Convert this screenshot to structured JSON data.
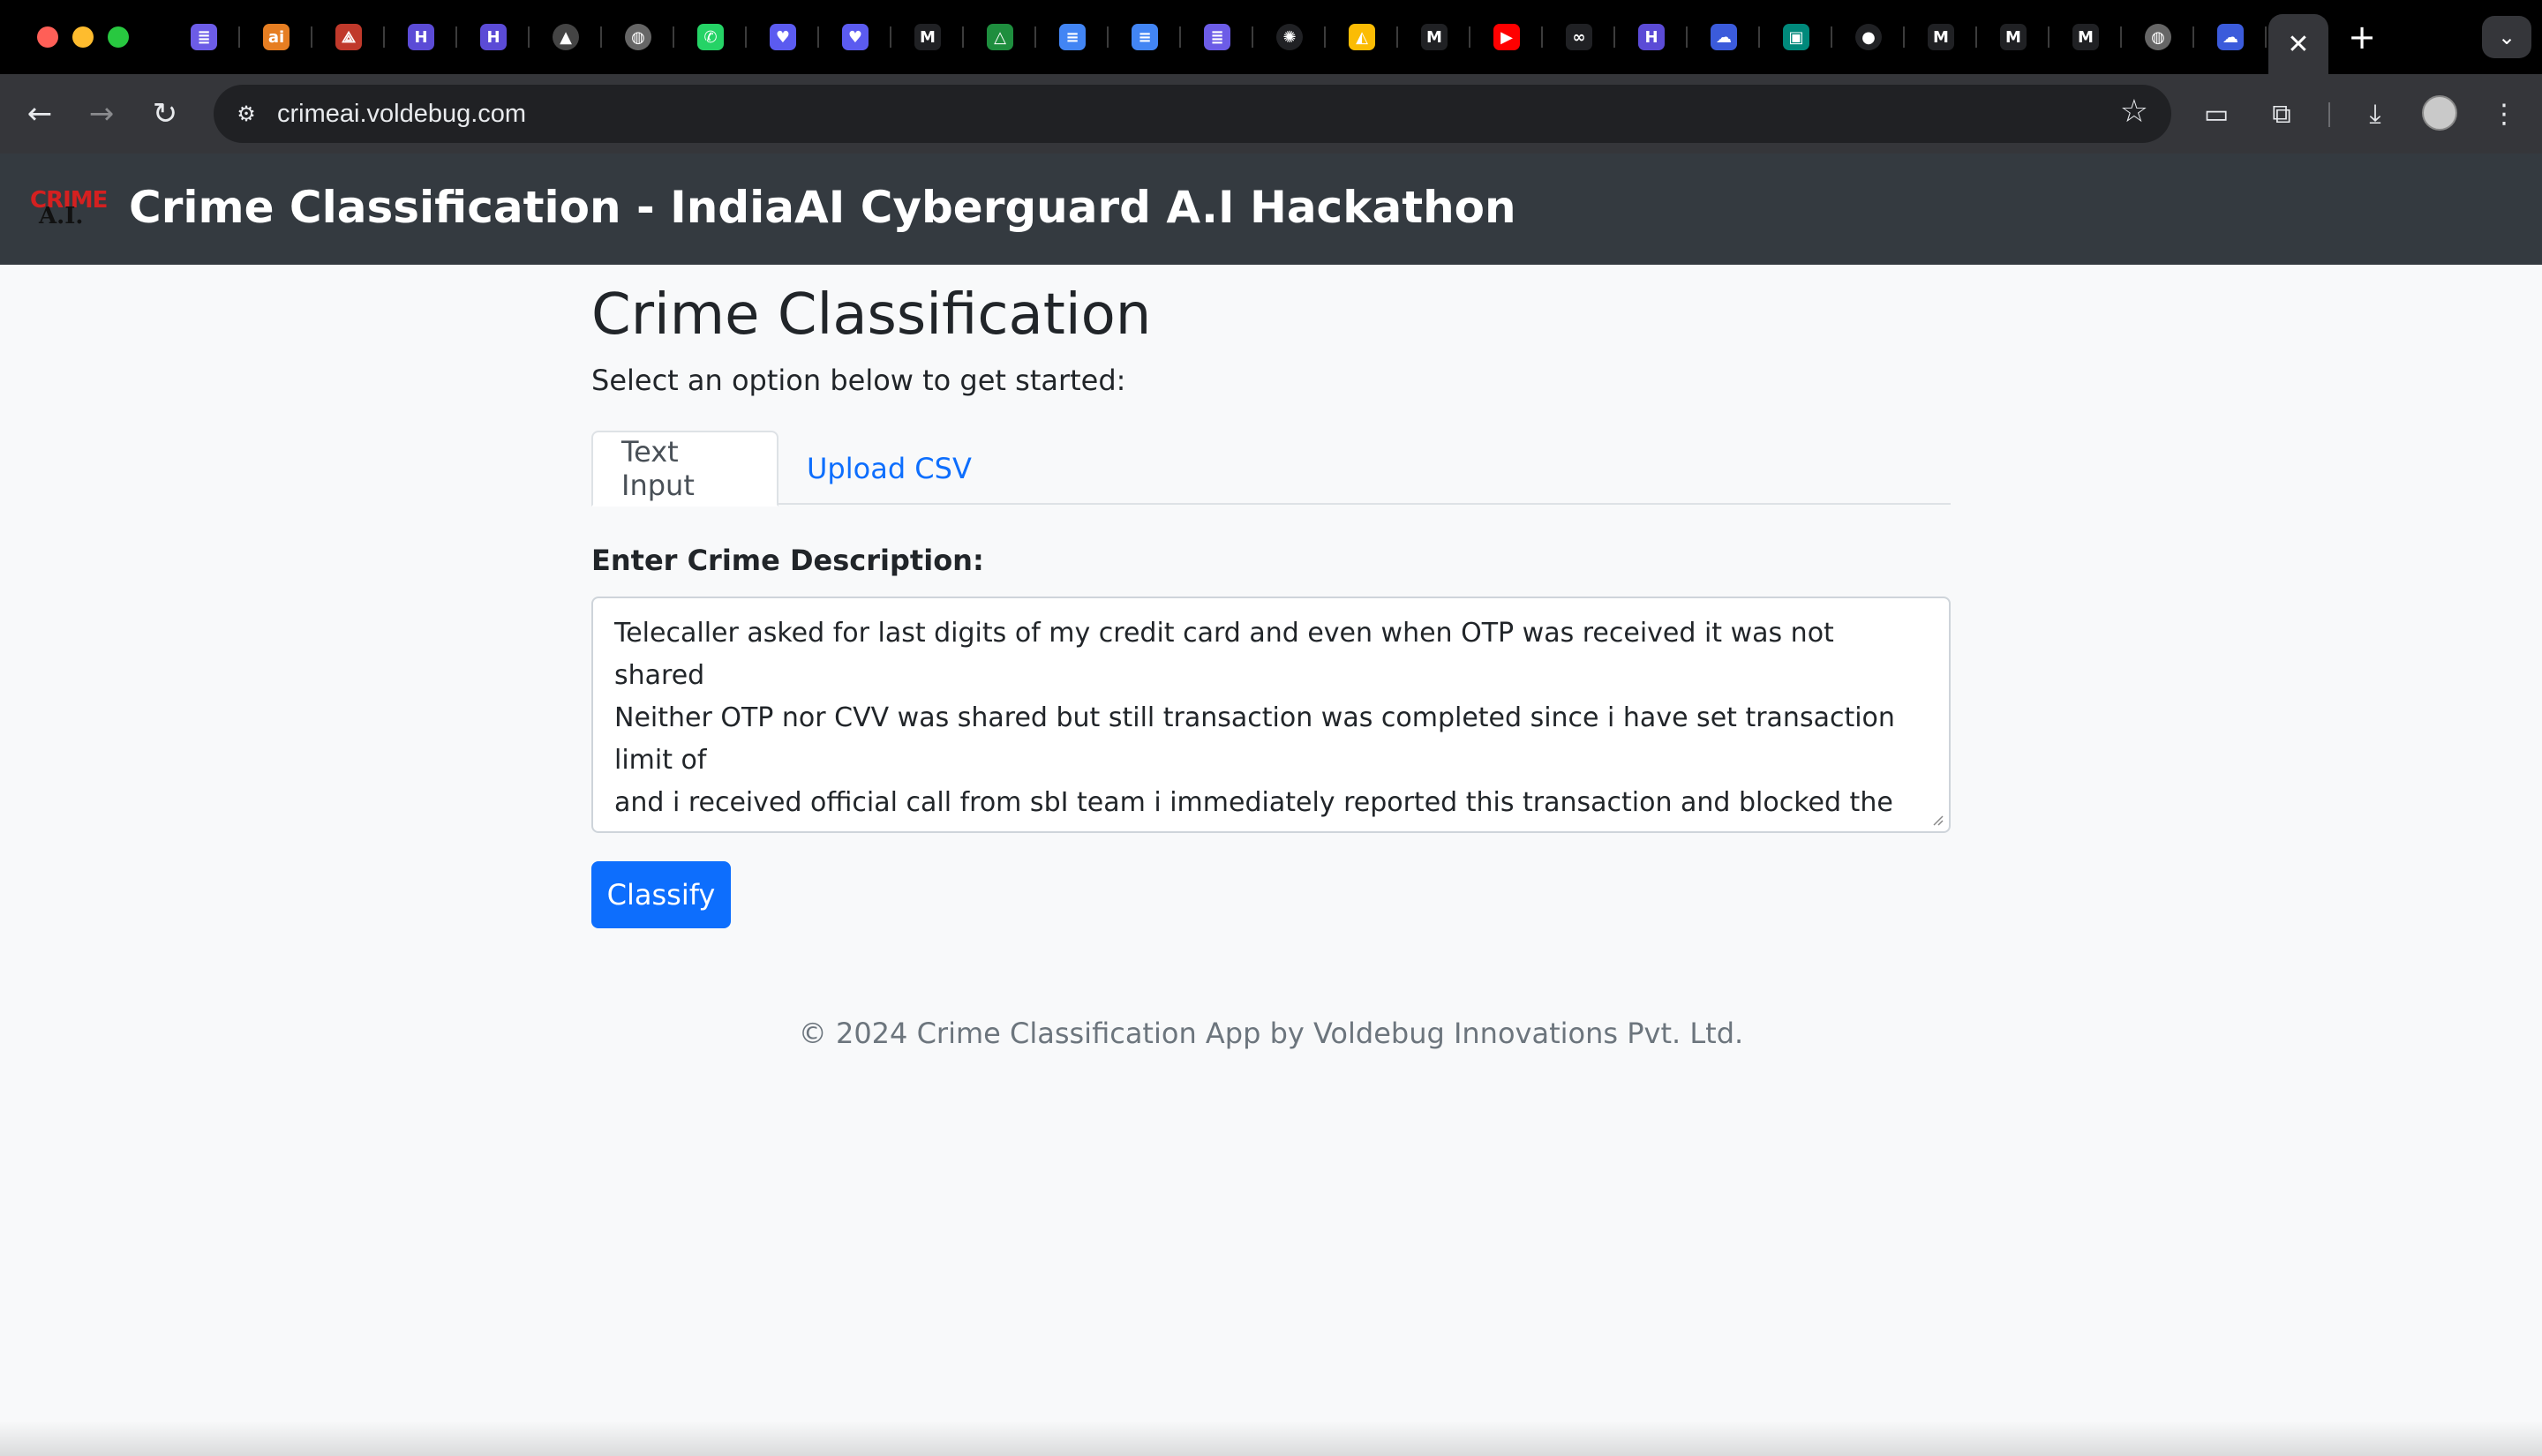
{
  "browser": {
    "tab_favicons": [
      {
        "name": "list-favicon-icon",
        "glyph": "≣",
        "bg": "#6c5ce7"
      },
      {
        "name": "ai-favicon-icon",
        "glyph": "ai",
        "bg": "#e67e22"
      },
      {
        "name": "pdf-favicon-icon",
        "glyph": "⟁",
        "bg": "#c0392b"
      },
      {
        "name": "h-favicon-icon",
        "glyph": "H",
        "bg": "#5b4bd6"
      },
      {
        "name": "h-favicon-icon",
        "glyph": "H",
        "bg": "#5b4bd6"
      },
      {
        "name": "triangle-favicon-icon",
        "glyph": "▲",
        "bg": "#444444"
      },
      {
        "name": "globe-favicon-icon",
        "glyph": "◍",
        "bg": "#666666"
      },
      {
        "name": "whatsapp-favicon-icon",
        "glyph": "✆",
        "bg": "#25d366"
      },
      {
        "name": "heart-chat-favicon-icon",
        "glyph": "♥",
        "bg": "#5b5bf0"
      },
      {
        "name": "heart-chat-favicon-icon",
        "glyph": "♥",
        "bg": "#5b5bf0"
      },
      {
        "name": "gmail-favicon-icon",
        "glyph": "M",
        "bg": "#202124"
      },
      {
        "name": "drive-favicon-icon",
        "glyph": "△",
        "bg": "#1e8e3e"
      },
      {
        "name": "docs-favicon-icon",
        "glyph": "≡",
        "bg": "#4285f4"
      },
      {
        "name": "docs-favicon-icon",
        "glyph": "≡",
        "bg": "#4285f4"
      },
      {
        "name": "list-favicon-icon",
        "glyph": "≣",
        "bg": "#6c5ce7"
      },
      {
        "name": "openai-favicon-icon",
        "glyph": "✺",
        "bg": "#202124"
      },
      {
        "name": "adwords-favicon-icon",
        "glyph": "◭",
        "bg": "#fbbc04"
      },
      {
        "name": "gmail-favicon-icon",
        "glyph": "M",
        "bg": "#202124"
      },
      {
        "name": "youtube-favicon-icon",
        "glyph": "▶",
        "bg": "#ff0000"
      },
      {
        "name": "infinity-favicon-icon",
        "glyph": "∞",
        "bg": "#202124"
      },
      {
        "name": "h-favicon-icon",
        "glyph": "H",
        "bg": "#5b4bd6"
      },
      {
        "name": "cloud-favicon-icon",
        "glyph": "☁",
        "bg": "#3b5bdb"
      },
      {
        "name": "meet-favicon-icon",
        "glyph": "▣",
        "bg": "#00897b"
      },
      {
        "name": "github-favicon-icon",
        "glyph": "●",
        "bg": "#202124"
      },
      {
        "name": "gmail-favicon-icon",
        "glyph": "M",
        "bg": "#202124"
      },
      {
        "name": "gmail-favicon-icon",
        "glyph": "M",
        "bg": "#202124"
      },
      {
        "name": "gmail-favicon-icon",
        "glyph": "M",
        "bg": "#202124"
      },
      {
        "name": "globe-favicon-icon",
        "glyph": "◍",
        "bg": "#666666"
      },
      {
        "name": "cloud-favicon-icon",
        "glyph": "☁",
        "bg": "#3b5bdb"
      }
    ],
    "active_tab_close_glyph": "✕",
    "new_tab_glyph": "+",
    "tab_list_glyph": "⌄",
    "back_glyph": "←",
    "forward_glyph": "→",
    "reload_glyph": "↻",
    "site_info_glyph": "⚙",
    "url": "crimeai.voldebug.com",
    "star_glyph": "☆",
    "cast_glyph": "▭",
    "extensions_glyph": "⧉",
    "download_glyph": "⤓",
    "menu_glyph": "⋮"
  },
  "navbar": {
    "logo_top": "CRIME",
    "logo_bottom": "A.I.",
    "brand": "Crime Classification - IndiaAI Cyberguard A.I Hackathon"
  },
  "main": {
    "title": "Crime Classification",
    "subtitle": "Select an option below to get started:",
    "tabs": [
      {
        "label": "Text Input",
        "active": true
      },
      {
        "label": "Upload CSV",
        "active": false
      }
    ],
    "form": {
      "label": "Enter Crime Description:",
      "value": "Telecaller asked for last digits of my credit card and even when OTP was received it was not shared\nNeither OTP nor CVV was shared but still transaction was completed since i have set transaction limit of\nand i received official call from sbI team i immediately reported this transaction and blocked the card",
      "submit_label": "Classify"
    }
  },
  "footer": {
    "text": "© 2024 Crime Classification App by Voldebug Innovations Pvt. Ltd."
  },
  "colors": {
    "navbar_bg": "#343a40",
    "primary": "#0d6efd",
    "page_bg": "#f8f9fa",
    "logo_red": "#d42020"
  }
}
